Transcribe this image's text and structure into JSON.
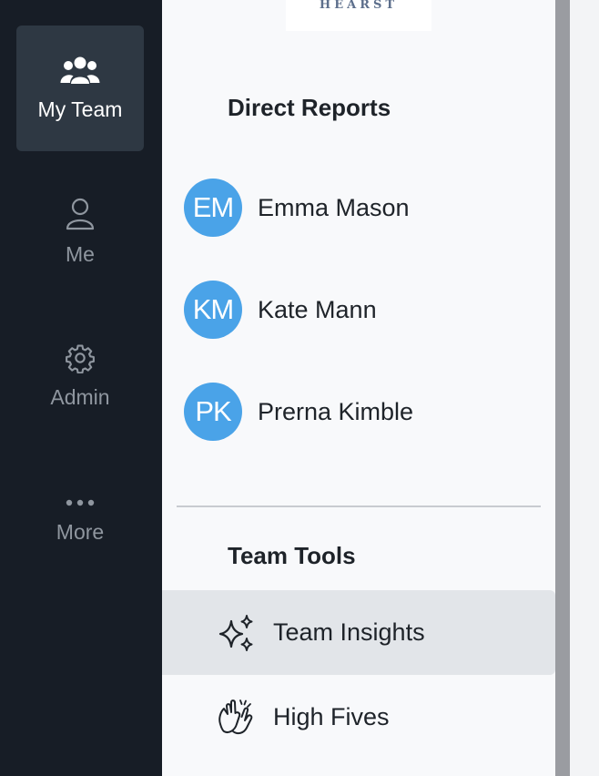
{
  "nav": {
    "items": [
      {
        "label": "My Team",
        "icon": "users-icon",
        "active": true
      },
      {
        "label": "Me",
        "icon": "person-icon",
        "active": false
      },
      {
        "label": "Admin",
        "icon": "gear-icon",
        "active": false
      },
      {
        "label": "More",
        "icon": "ellipsis-icon",
        "active": false
      }
    ]
  },
  "panel": {
    "logo_text": "HEARST",
    "direct_reports": {
      "title": "Direct Reports",
      "people": [
        {
          "initials": "EM",
          "name": "Emma Mason"
        },
        {
          "initials": "KM",
          "name": "Kate Mann"
        },
        {
          "initials": "PK",
          "name": "Prerna Kimble"
        }
      ]
    },
    "team_tools": {
      "title": "Team Tools",
      "items": [
        {
          "label": "Team Insights",
          "icon": "sparkles-icon",
          "active": true
        },
        {
          "label": "High Fives",
          "icon": "clapping-hands-icon",
          "active": false
        }
      ]
    }
  },
  "colors": {
    "rail_background": "#171d26",
    "rail_active": "#2e3843",
    "avatar": "#4aa3e8",
    "panel_background": "#f8f9fb",
    "tool_active": "#e2e5e9"
  }
}
